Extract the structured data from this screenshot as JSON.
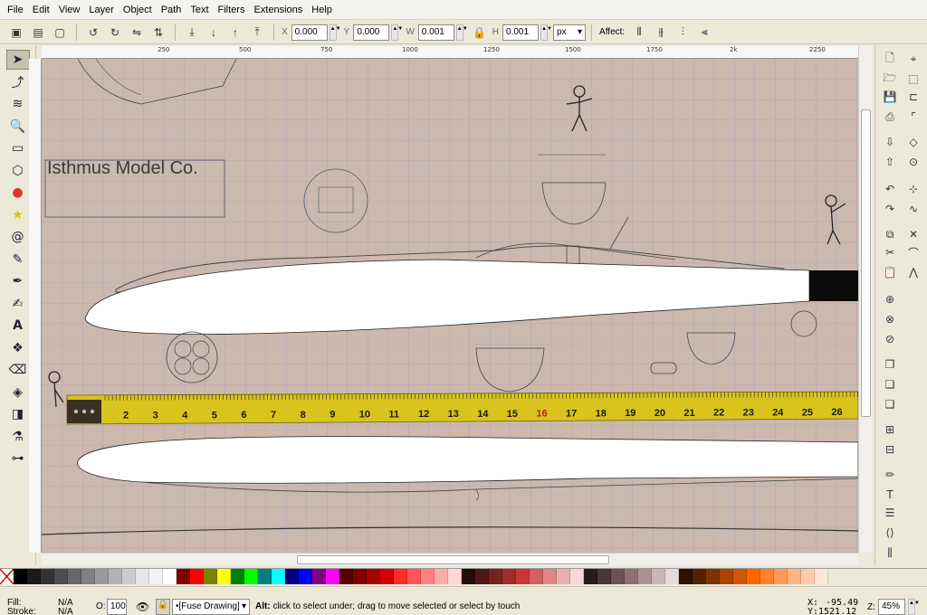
{
  "menu": [
    "File",
    "Edit",
    "View",
    "Layer",
    "Object",
    "Path",
    "Text",
    "Filters",
    "Extensions",
    "Help"
  ],
  "toolbar": {
    "x_label": "X",
    "x_value": "0.000",
    "y_label": "Y",
    "y_value": "0.000",
    "w_label": "W",
    "w_value": "0.001",
    "h_label": "H",
    "h_value": "0.001",
    "unit": "px",
    "affect_label": "Affect:"
  },
  "ruler": {
    "h_ticks": [
      "250",
      "500",
      "750",
      "1000",
      "1250",
      "1500",
      "1750",
      "2k",
      "2250"
    ]
  },
  "canvas": {
    "company_name": "Isthmus Model Co."
  },
  "tape_numbers": [
    "2",
    "3",
    "4",
    "5",
    "6",
    "7",
    "8",
    "9",
    "10",
    "11",
    "12",
    "13",
    "14",
    "15",
    "16",
    "17",
    "18",
    "19",
    "20",
    "21",
    "22",
    "23",
    "24",
    "25",
    "26"
  ],
  "palette_colors": [
    "#000000",
    "#1a1a1a",
    "#333333",
    "#4d4d4d",
    "#666666",
    "#808080",
    "#999999",
    "#b3b3b3",
    "#cccccc",
    "#e6e6e6",
    "#f2f2f2",
    "#ffffff",
    "#800000",
    "#ff0000",
    "#808000",
    "#ffff00",
    "#008000",
    "#00ff00",
    "#008080",
    "#00ffff",
    "#000080",
    "#0000ff",
    "#800080",
    "#ff00ff",
    "#550000",
    "#800000",
    "#aa0000",
    "#d40000",
    "#ff2a2a",
    "#ff5555",
    "#ff8080",
    "#ffaaaa",
    "#ffd5d5",
    "#280b0b",
    "#501616",
    "#782121",
    "#a02c2c",
    "#c83737",
    "#d35f5f",
    "#de8787",
    "#e9afaf",
    "#f4d7d7",
    "#241c1c",
    "#483737",
    "#6c5353",
    "#916f6f",
    "#ac9393",
    "#c8b7b7",
    "#e3dbdb",
    "#2b1100",
    "#552200",
    "#803300",
    "#aa4400",
    "#d45500",
    "#ff6600",
    "#ff7f2a",
    "#ff9955",
    "#ffb380",
    "#ffccaa",
    "#ffe6d5"
  ],
  "status": {
    "fill_label": "Fill:",
    "fill_value": "N/A",
    "stroke_label": "Stroke:",
    "stroke_value": "N/A",
    "opacity_label": "O:",
    "opacity_value": "100",
    "layer": "•[Fuse Drawing]",
    "message_bold": "Alt:",
    "message": " click to select under; drag to move selected or select by touch",
    "x_label": "X:",
    "x_value": "-95.49",
    "y_label": "Y:",
    "y_value": "1521.12",
    "z_label": "Z:",
    "zoom_value": "45%"
  }
}
